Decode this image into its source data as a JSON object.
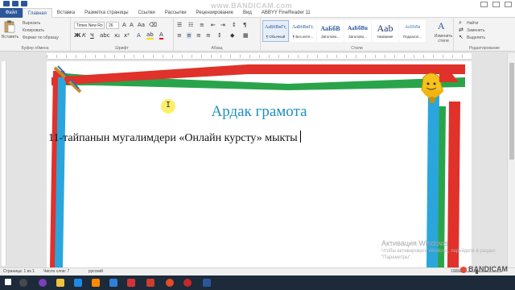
{
  "app": {
    "watermark_top": "www.BANDICAM.com",
    "file_tab": "Файл",
    "tabs": [
      "Главная",
      "Вставка",
      "Разметка страницы",
      "Ссылки",
      "Рассылки",
      "Рецензирование",
      "Вид",
      "ABBYY FineReader 11"
    ]
  },
  "ribbon": {
    "clipboard": {
      "paste": "Вставить",
      "cut": "Вырезать",
      "copy": "Копировать",
      "format_painter": "Формат по образцу",
      "label": "Буфер обмена"
    },
    "font": {
      "family": "Times New Ro",
      "size": "26",
      "label": "Шрифт"
    },
    "paragraph": {
      "label": "Абзац"
    },
    "styles": {
      "label": "Стили",
      "items": [
        {
          "sample": "АаБбВвГг,",
          "name": "¶ Обычный"
        },
        {
          "sample": "АаБбВвГг,",
          "name": "¶ Без инте..."
        },
        {
          "sample": "АаБбВ",
          "name": "Заголово..."
        },
        {
          "sample": "АаБбВв",
          "name": "Заголово..."
        },
        {
          "sample": "Aab",
          "name": "Название"
        },
        {
          "sample": "АаБбВв",
          "name": "Подзагол..."
        }
      ],
      "change_styles": "Изменить стили"
    },
    "editing": {
      "label": "Редактирование",
      "find": "Найти",
      "replace": "Заменить",
      "select": "Выделить"
    }
  },
  "document": {
    "title": "Ардак грамота",
    "line": "11-тайпанын мугалимдери «Онлайн курсту» мыкты"
  },
  "watermark": {
    "title": "Активация Windows",
    "subtitle": "Чтобы активировать Windows, перейдите в раздел \"Параметры\"."
  },
  "status": {
    "page": "Страница: 1 из 1",
    "words": "Число слов: 7",
    "lang": "русский",
    "zoom": "100%",
    "bandicam": "BANDICAM"
  },
  "colors": {
    "accent": "#2b579a",
    "title": "#1e8fbf"
  }
}
